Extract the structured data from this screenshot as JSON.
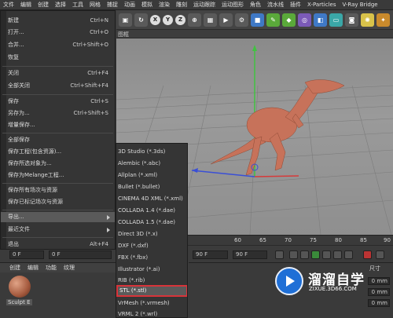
{
  "menubar": {
    "items": [
      "文件",
      "编辑",
      "创建",
      "选择",
      "工具",
      "网格",
      "捕捉",
      "动画",
      "模拟",
      "渲染",
      "雕刻",
      "运动跟踪",
      "运动图形",
      "角色",
      "流水线",
      "插件",
      "X-Particles",
      "V-Ray Bridge"
    ]
  },
  "toolbar": {
    "icons": [
      "X",
      "Y",
      "Z"
    ]
  },
  "viewport": {
    "header_label": "图框"
  },
  "file_menu": {
    "items": [
      {
        "label": "新建",
        "shortcut": "Ctrl+N"
      },
      {
        "label": "打开...",
        "shortcut": "Ctrl+O"
      },
      {
        "label": "合并...",
        "shortcut": "Ctrl+Shift+O"
      },
      {
        "label": "恢复",
        "shortcut": ""
      },
      {
        "label": "关闭",
        "shortcut": "Ctrl+F4"
      },
      {
        "label": "全部关闭",
        "shortcut": "Ctrl+Shift+F4"
      },
      {
        "label": "保存",
        "shortcut": "Ctrl+S"
      },
      {
        "label": "另存为...",
        "shortcut": "Ctrl+Shift+S"
      },
      {
        "label": "增量保存...",
        "shortcut": ""
      },
      {
        "label": "全部保存",
        "shortcut": ""
      },
      {
        "label": "保存工程(包含资源)...",
        "shortcut": ""
      },
      {
        "label": "保存所选对象为...",
        "shortcut": ""
      },
      {
        "label": "保存为Melange工程...",
        "shortcut": ""
      },
      {
        "label": "保存所有场次与资源",
        "shortcut": ""
      },
      {
        "label": "保存已标记场次与资源",
        "shortcut": ""
      },
      {
        "label": "导出...",
        "shortcut": ""
      },
      {
        "label": "最近文件",
        "shortcut": ""
      },
      {
        "label": "退出",
        "shortcut": "Alt+F4"
      }
    ]
  },
  "export_menu": {
    "items": [
      "3D Studio (*.3ds)",
      "Alembic (*.abc)",
      "Allplan (*.xml)",
      "Bullet (*.bullet)",
      "CINEMA 4D XML (*.xml)",
      "COLLADA 1.4 (*.dae)",
      "COLLADA 1.5 (*.dae)",
      "Direct 3D (*.x)",
      "DXF (*.dxf)",
      "FBX (*.fbx)",
      "Illustrator (*.ai)",
      "RIB (*.rib)",
      "STL (*.stl)",
      "VrMesh (*.vrmesh)",
      "VRML 2 (*.wrl)"
    ],
    "selected": "STL (*.stl)"
  },
  "timeline": {
    "ticks": [
      "60",
      "65",
      "70",
      "75",
      "80",
      "85",
      "90"
    ],
    "start_field": "0 F",
    "current_field": "0 F",
    "end_field": "90 F",
    "max_field": "90 F"
  },
  "material_panel": {
    "tabs": [
      "创建",
      "编辑",
      "功能",
      "纹理"
    ],
    "material_name": "Sculpt E"
  },
  "attr_panel": {
    "label": "尺寸",
    "fields": [
      "0 mm",
      "0 mm",
      "0 mm"
    ]
  },
  "watermark": {
    "title": "溜溜自学",
    "url": "ZIXUE.3D66.COM"
  },
  "colors": {
    "dino": "#c7725a",
    "highlight_border": "#d8343a",
    "watermark_blue": "#1f6fd6"
  }
}
